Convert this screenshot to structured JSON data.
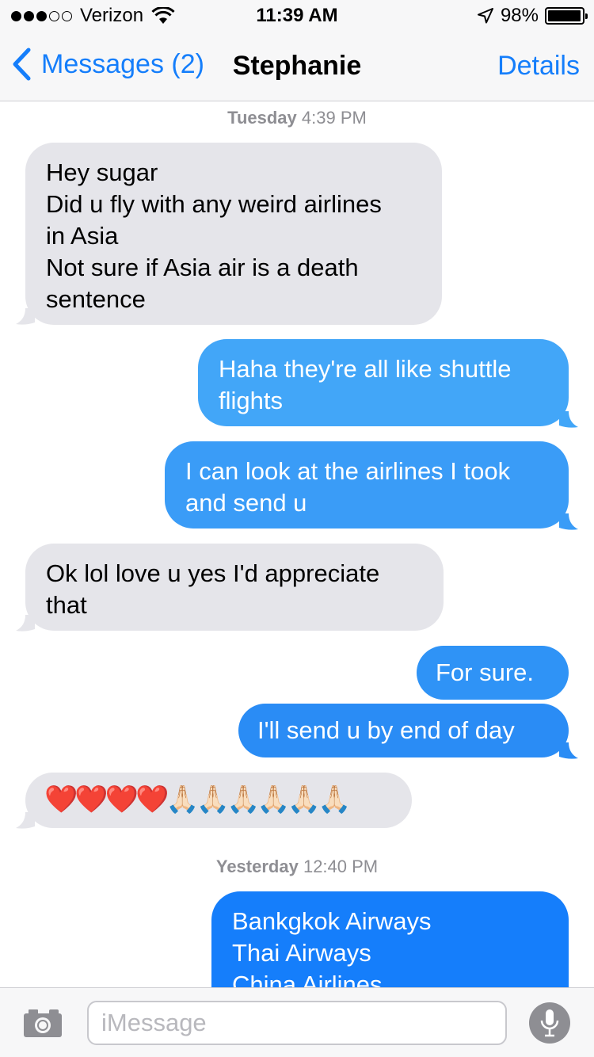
{
  "status_bar": {
    "carrier": "Verizon",
    "time": "11:39 AM",
    "battery": "98%",
    "battery_level": 0.98,
    "signal_bars": 3,
    "signal_total": 5
  },
  "nav": {
    "back_label": "Messages (2)",
    "title": "Stephanie",
    "details_label": "Details"
  },
  "timestamps": [
    {
      "day": "Tuesday",
      "time": "4:39 PM"
    },
    {
      "day": "Yesterday",
      "time": "12:40 PM"
    }
  ],
  "messages": [
    {
      "direction": "incoming",
      "text": "Hey sugar\nDid u fly with any weird airlines\nin Asia\nNot sure if Asia air is a death\nsentence"
    },
    {
      "direction": "outgoing",
      "text": "Haha they're all like shuttle\nflights"
    },
    {
      "direction": "outgoing",
      "text": "I can look at the airlines I took\nand send u"
    },
    {
      "direction": "incoming",
      "text": "Ok lol love u yes I'd  appreciate\nthat"
    },
    {
      "direction": "outgoing",
      "text": "For sure."
    },
    {
      "direction": "outgoing",
      "text": "I'll send u by end of day"
    },
    {
      "direction": "incoming",
      "text": "❤️❤️❤️❤️🙏🏻🙏🏻🙏🏻🙏🏻🙏🏻🙏🏻"
    },
    {
      "direction": "outgoing",
      "text": "Bankgkok Airways\nThai Airways\nChina Airlines"
    }
  ],
  "input": {
    "placeholder": "iMessage"
  },
  "colors": {
    "ios_blue": "#157efb",
    "outgoing_bubble": "#2a8cf5",
    "incoming_bubble": "#e5e5ea",
    "bar_background": "#f7f7f8"
  },
  "icons": [
    "signal-dots",
    "wifi-icon",
    "location-arrow-icon",
    "battery-icon",
    "back-chevron-icon",
    "camera-icon",
    "microphone-icon"
  ]
}
